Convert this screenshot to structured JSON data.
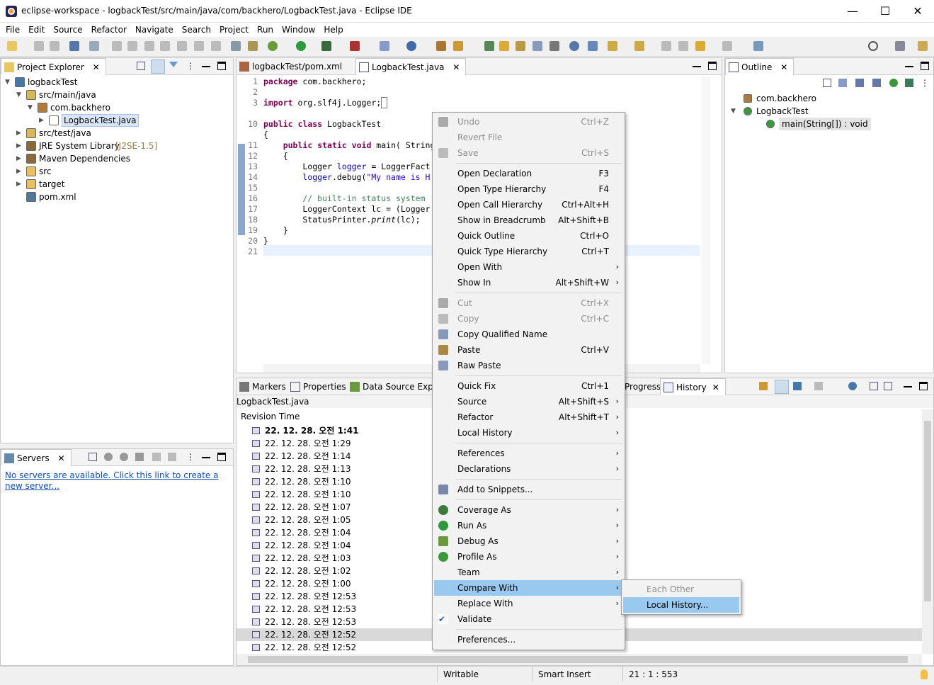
{
  "window": {
    "title": "eclipse-workspace - logbackTest/src/main/java/com/backhero/LogbackTest.java - Eclipse IDE",
    "minimize": "—",
    "maximize": "☐",
    "close": "✕"
  },
  "menubar": [
    "File",
    "Edit",
    "Source",
    "Refactor",
    "Navigate",
    "Search",
    "Project",
    "Run",
    "Window",
    "Help"
  ],
  "project_explorer": {
    "title": "Project Explorer",
    "items": [
      {
        "label": "logbackTest",
        "depth": 0,
        "expanded": true,
        "icon": "project-icon"
      },
      {
        "label": "src/main/java",
        "depth": 1,
        "expanded": true,
        "icon": "source-folder-icon"
      },
      {
        "label": "com.backhero",
        "depth": 2,
        "expanded": true,
        "icon": "package-icon"
      },
      {
        "label": "LogbackTest.java",
        "depth": 3,
        "expanded": false,
        "icon": "java-file-icon",
        "selected": true
      },
      {
        "label": "src/test/java",
        "depth": 1,
        "expanded": false,
        "icon": "source-folder-icon"
      },
      {
        "label": "JRE System Library",
        "suffix": "[J2SE-1.5]",
        "depth": 1,
        "expanded": false,
        "icon": "library-icon"
      },
      {
        "label": "Maven Dependencies",
        "depth": 1,
        "expanded": false,
        "icon": "library-icon"
      },
      {
        "label": "src",
        "depth": 1,
        "expanded": false,
        "icon": "folder-icon"
      },
      {
        "label": "target",
        "depth": 1,
        "expanded": false,
        "icon": "folder-icon"
      },
      {
        "label": "pom.xml",
        "depth": 1,
        "expanded": null,
        "icon": "xml-file-icon"
      }
    ]
  },
  "servers": {
    "title": "Servers",
    "message": "No servers are available. Click this link to create a new server..."
  },
  "editor": {
    "tabs": [
      {
        "label": "logbackTest/pom.xml",
        "active": false
      },
      {
        "label": "LogbackTest.java",
        "active": true
      }
    ],
    "line_numbers": [
      "1",
      "2",
      "3",
      "10",
      "11",
      "12",
      "13",
      "14",
      "15",
      "16",
      "17",
      "18",
      "19",
      "20",
      "21"
    ]
  },
  "outline": {
    "title": "Outline",
    "items": [
      {
        "label": "com.backhero",
        "depth": 0,
        "icon": "package-icon"
      },
      {
        "label": "LogbackTest",
        "depth": 0,
        "icon": "class-icon",
        "expanded": true
      },
      {
        "label": "main(String[]) : void",
        "depth": 1,
        "icon": "method-icon",
        "selected": true
      }
    ]
  },
  "bottom": {
    "tabs": [
      "Markers",
      "Properties",
      "Data Source Explo",
      "Progress",
      "History"
    ],
    "file_label": "LogbackTest.java",
    "column_header": "Revision Time",
    "rows": [
      "22. 12. 28. 오전 1:41",
      "22. 12. 28. 오전 1:29",
      "22. 12. 28. 오전 1:14",
      "22. 12. 28. 오전 1:13",
      "22. 12. 28. 오전 1:10",
      "22. 12. 28. 오전 1:10",
      "22. 12. 28. 오전 1:07",
      "22. 12. 28. 오전 1:05",
      "22. 12. 28. 오전 1:04",
      "22. 12. 28. 오전 1:04",
      "22. 12. 28. 오전 1:03",
      "22. 12. 28. 오전 1:02",
      "22. 12. 28. 오전 1:00",
      "22. 12. 28. 오전 12:53",
      "22. 12. 28. 오전 12:53",
      "22. 12. 28. 오전 12:53",
      "22. 12. 28. 오전 12:52",
      "22. 12. 28. 오전 12:52"
    ]
  },
  "context_menu": [
    {
      "label": "Undo",
      "shortcut": "Ctrl+Z",
      "disabled": true,
      "icon": "undo-icon"
    },
    {
      "label": "Revert File",
      "shortcut": "",
      "disabled": true
    },
    {
      "label": "Save",
      "shortcut": "Ctrl+S",
      "disabled": true,
      "icon": "save-icon"
    },
    {
      "sep": true
    },
    {
      "label": "Open Declaration",
      "shortcut": "F3"
    },
    {
      "label": "Open Type Hierarchy",
      "shortcut": "F4"
    },
    {
      "label": "Open Call Hierarchy",
      "shortcut": "Ctrl+Alt+H"
    },
    {
      "label": "Show in Breadcrumb",
      "shortcut": "Alt+Shift+B"
    },
    {
      "label": "Quick Outline",
      "shortcut": "Ctrl+O"
    },
    {
      "label": "Quick Type Hierarchy",
      "shortcut": "Ctrl+T"
    },
    {
      "label": "Open With",
      "shortcut": "",
      "submenu": true
    },
    {
      "label": "Show In",
      "shortcut": "Alt+Shift+W",
      "submenu": true
    },
    {
      "sep": true
    },
    {
      "label": "Cut",
      "shortcut": "Ctrl+X",
      "disabled": true,
      "icon": "cut-icon"
    },
    {
      "label": "Copy",
      "shortcut": "Ctrl+C",
      "disabled": true,
      "icon": "copy-icon"
    },
    {
      "label": "Copy Qualified Name",
      "shortcut": "",
      "icon": "copy-qualified-icon"
    },
    {
      "label": "Paste",
      "shortcut": "Ctrl+V",
      "icon": "paste-icon"
    },
    {
      "label": "Raw Paste",
      "shortcut": "",
      "icon": "raw-paste-icon"
    },
    {
      "sep": true
    },
    {
      "label": "Quick Fix",
      "shortcut": "Ctrl+1"
    },
    {
      "label": "Source",
      "shortcut": "Alt+Shift+S",
      "submenu": true
    },
    {
      "label": "Refactor",
      "shortcut": "Alt+Shift+T",
      "submenu": true
    },
    {
      "label": "Local History",
      "shortcut": "",
      "submenu": true
    },
    {
      "sep": true
    },
    {
      "label": "References",
      "shortcut": "",
      "submenu": true
    },
    {
      "label": "Declarations",
      "shortcut": "",
      "submenu": true
    },
    {
      "sep": true
    },
    {
      "label": "Add to Snippets...",
      "shortcut": "",
      "icon": "snippets-icon"
    },
    {
      "sep": true
    },
    {
      "label": "Coverage As",
      "shortcut": "",
      "submenu": true,
      "icon": "coverage-icon"
    },
    {
      "label": "Run As",
      "shortcut": "",
      "submenu": true,
      "icon": "run-icon"
    },
    {
      "label": "Debug As",
      "shortcut": "",
      "submenu": true,
      "icon": "debug-icon"
    },
    {
      "label": "Profile As",
      "shortcut": "",
      "submenu": true,
      "icon": "profile-icon"
    },
    {
      "label": "Team",
      "shortcut": "",
      "submenu": true
    },
    {
      "label": "Compare With",
      "shortcut": "",
      "submenu": true,
      "selected": true
    },
    {
      "label": "Replace With",
      "shortcut": "",
      "submenu": true
    },
    {
      "label": "Validate",
      "shortcut": "",
      "icon": "check-icon"
    },
    {
      "sep": true
    },
    {
      "label": "Preferences...",
      "shortcut": ""
    }
  ],
  "submenu": [
    {
      "label": "Each Other",
      "disabled": true
    },
    {
      "label": "Local History...",
      "selected": true
    }
  ],
  "status": {
    "mode": "Writable",
    "insert": "Smart Insert",
    "position": "21 : 1 : 553"
  }
}
